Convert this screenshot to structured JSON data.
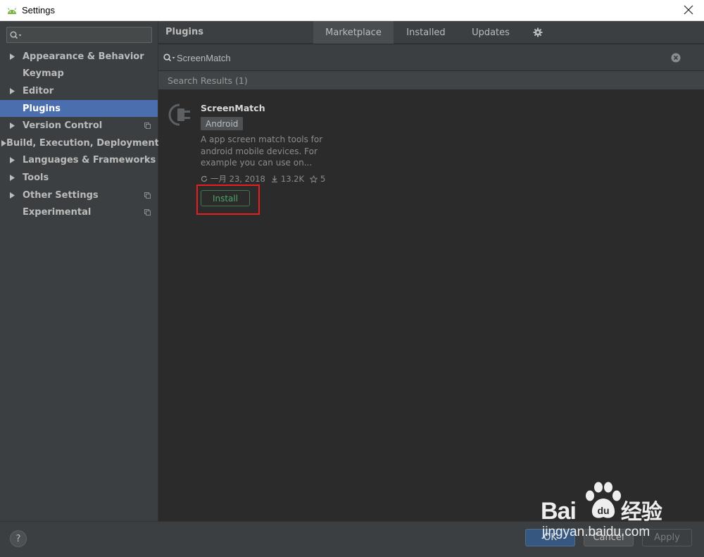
{
  "window": {
    "title": "Settings"
  },
  "sidebar": {
    "search_value": "",
    "items": [
      {
        "label": "Appearance & Behavior",
        "expandable": true,
        "project": false,
        "selected": false
      },
      {
        "label": "Keymap",
        "expandable": false,
        "project": false,
        "selected": false
      },
      {
        "label": "Editor",
        "expandable": true,
        "project": false,
        "selected": false
      },
      {
        "label": "Plugins",
        "expandable": false,
        "project": false,
        "selected": true
      },
      {
        "label": "Version Control",
        "expandable": true,
        "project": true,
        "selected": false
      },
      {
        "label": "Build, Execution, Deployment",
        "expandable": true,
        "project": false,
        "selected": false
      },
      {
        "label": "Languages & Frameworks",
        "expandable": true,
        "project": false,
        "selected": false
      },
      {
        "label": "Tools",
        "expandable": true,
        "project": false,
        "selected": false
      },
      {
        "label": "Other Settings",
        "expandable": true,
        "project": true,
        "selected": false
      },
      {
        "label": "Experimental",
        "expandable": false,
        "project": true,
        "selected": false
      }
    ]
  },
  "plugins": {
    "heading": "Plugins",
    "tabs": [
      "Marketplace",
      "Installed",
      "Updates"
    ],
    "active_tab": "Marketplace",
    "search_value": "ScreenMatch",
    "results_header": "Search Results (1)",
    "result": {
      "name": "ScreenMatch",
      "tag": "Android",
      "description_lines": [
        "A app screen match tools for",
        "android mobile devices. For",
        "example you can use on..."
      ],
      "date": "一月 23, 2018",
      "downloads": "13.2K",
      "rating": "5",
      "install_label": "Install"
    }
  },
  "footer": {
    "help_label": "?",
    "ok_label": "OK",
    "cancel_label": "Cancel",
    "apply_label": "Apply"
  },
  "watermark": {
    "brand": "Bai",
    "brand_cn": "经验",
    "url": "jingyan.baidu.com"
  },
  "colors": {
    "selection": "#4b6eaf",
    "install_green": "#4ea662",
    "highlight_red": "#e51e1e",
    "ok_blue": "#365880"
  }
}
